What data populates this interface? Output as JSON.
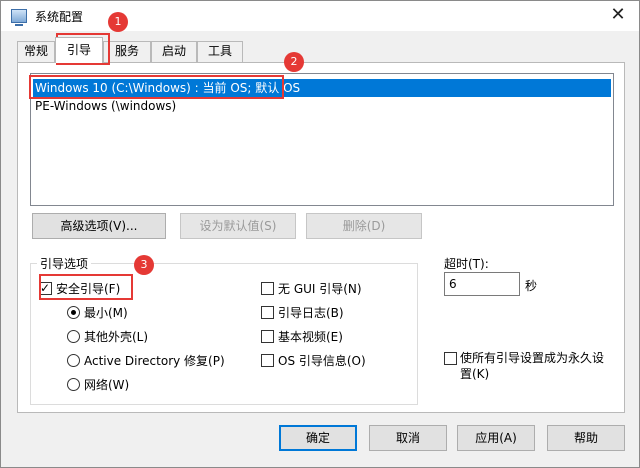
{
  "window": {
    "title": "系统配置",
    "close_symbol": "✕"
  },
  "tabs": [
    {
      "label": "常规"
    },
    {
      "label": "引导"
    },
    {
      "label": "服务"
    },
    {
      "label": "启动"
    },
    {
      "label": "工具"
    }
  ],
  "active_tab": "引导",
  "os_list": [
    {
      "label": "Windows 10 (C:\\Windows) : 当前 OS; 默认 OS",
      "selected": true
    },
    {
      "label": "PE-Windows (\\windows)",
      "selected": false
    }
  ],
  "list_buttons": {
    "advanced": "高级选项(V)...",
    "set_default": "设为默认值(S)",
    "delete": "删除(D)"
  },
  "boot_options": {
    "title": "引导选项",
    "safe_boot": {
      "label": "安全引导(F)",
      "checked": true
    },
    "radios": [
      {
        "label": "最小(M)",
        "checked": true
      },
      {
        "label": "其他外壳(L)",
        "checked": false
      },
      {
        "label": "Active Directory 修复(P)",
        "checked": false
      },
      {
        "label": "网络(W)",
        "checked": false
      }
    ],
    "right_checks": [
      {
        "label": "无 GUI 引导(N)",
        "checked": false
      },
      {
        "label": "引导日志(B)",
        "checked": false
      },
      {
        "label": "基本视频(E)",
        "checked": false
      },
      {
        "label": "OS 引导信息(O)",
        "checked": false
      }
    ]
  },
  "timeout": {
    "label": "超时(T):",
    "value": "6",
    "unit": "秒"
  },
  "permanent": {
    "label": "使所有引导设置成为永久设置(K)",
    "checked": false
  },
  "dialog_buttons": {
    "ok": "确定",
    "cancel": "取消",
    "apply": "应用(A)",
    "help": "帮助"
  },
  "annotations": [
    {
      "number": "1"
    },
    {
      "number": "2"
    },
    {
      "number": "3"
    }
  ],
  "colors": {
    "selection": "#0078d7",
    "annotation": "#e53935"
  }
}
